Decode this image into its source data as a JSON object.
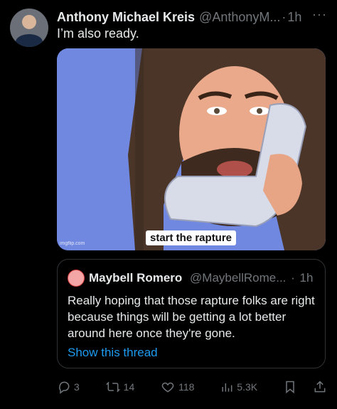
{
  "tweet": {
    "author_name": "Anthony Michael Kreis",
    "author_handle": "@AnthonyM...",
    "separator": "·",
    "time": "1h",
    "text": "I’m also ready."
  },
  "media": {
    "caption": "start the rapture",
    "watermark": "imgflip.com"
  },
  "quote": {
    "author_name": "Maybell Romero",
    "author_handle": "@MaybellRome...",
    "separator": "·",
    "time": "1h",
    "text": "Really hoping that those rapture folks are right because things will be getting a lot better around here once they're gone.",
    "link": "Show this thread"
  },
  "actions": {
    "replies": "3",
    "retweets": "14",
    "likes": "118",
    "views": "5.3K"
  },
  "colors": {
    "background": "#000000",
    "text": "#e7e9ea",
    "muted": "#71767b",
    "link": "#1d9bf0",
    "border": "#2f3336"
  }
}
